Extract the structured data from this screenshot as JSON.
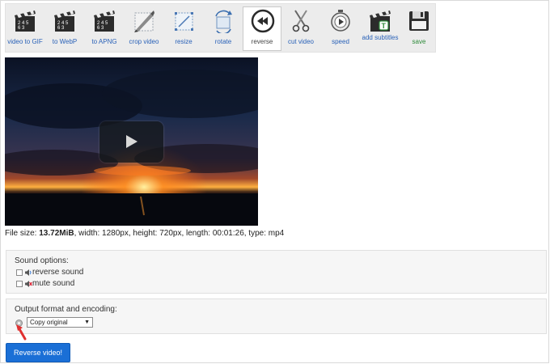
{
  "toolbar": {
    "items": [
      {
        "id": "video-to-gif",
        "label": "video to GIF",
        "icon": "clapperboard-icon"
      },
      {
        "id": "to-webp",
        "label": "to WebP",
        "icon": "clapperboard-icon"
      },
      {
        "id": "to-apng",
        "label": "to APNG",
        "icon": "clapperboard-icon"
      },
      {
        "id": "crop-video",
        "label": "crop video",
        "icon": "crop-icon"
      },
      {
        "id": "resize",
        "label": "resize",
        "icon": "resize-icon"
      },
      {
        "id": "rotate",
        "label": "rotate",
        "icon": "rotate-icon"
      },
      {
        "id": "reverse",
        "label": "reverse",
        "icon": "rewind-icon",
        "active": true
      },
      {
        "id": "cut-video",
        "label": "cut video",
        "icon": "scissors-icon"
      },
      {
        "id": "speed",
        "label": "speed",
        "icon": "stopwatch-icon"
      },
      {
        "id": "add-subtitles",
        "label": "add subtitles",
        "icon": "subtitles-icon"
      },
      {
        "id": "save",
        "label": "save",
        "icon": "floppy-disk-icon"
      }
    ]
  },
  "video": {
    "play_icon": "play-icon"
  },
  "fileinfo": {
    "prefix": "File size: ",
    "size": "13.72MiB",
    "rest": ", width: 1280px, height: 720px, length: 00:01:26, type: mp4"
  },
  "sound": {
    "title": "Sound options:",
    "reverse_label": "reverse sound",
    "mute_label": "mute sound"
  },
  "output": {
    "title": "Output format and encoding:",
    "selected": "Copy original"
  },
  "action": {
    "button_label": "Reverse video!"
  },
  "colors": {
    "accent": "#1a6fd6",
    "link": "#2a62b8",
    "save": "#2e8b3a",
    "pointer": "#e03030"
  }
}
